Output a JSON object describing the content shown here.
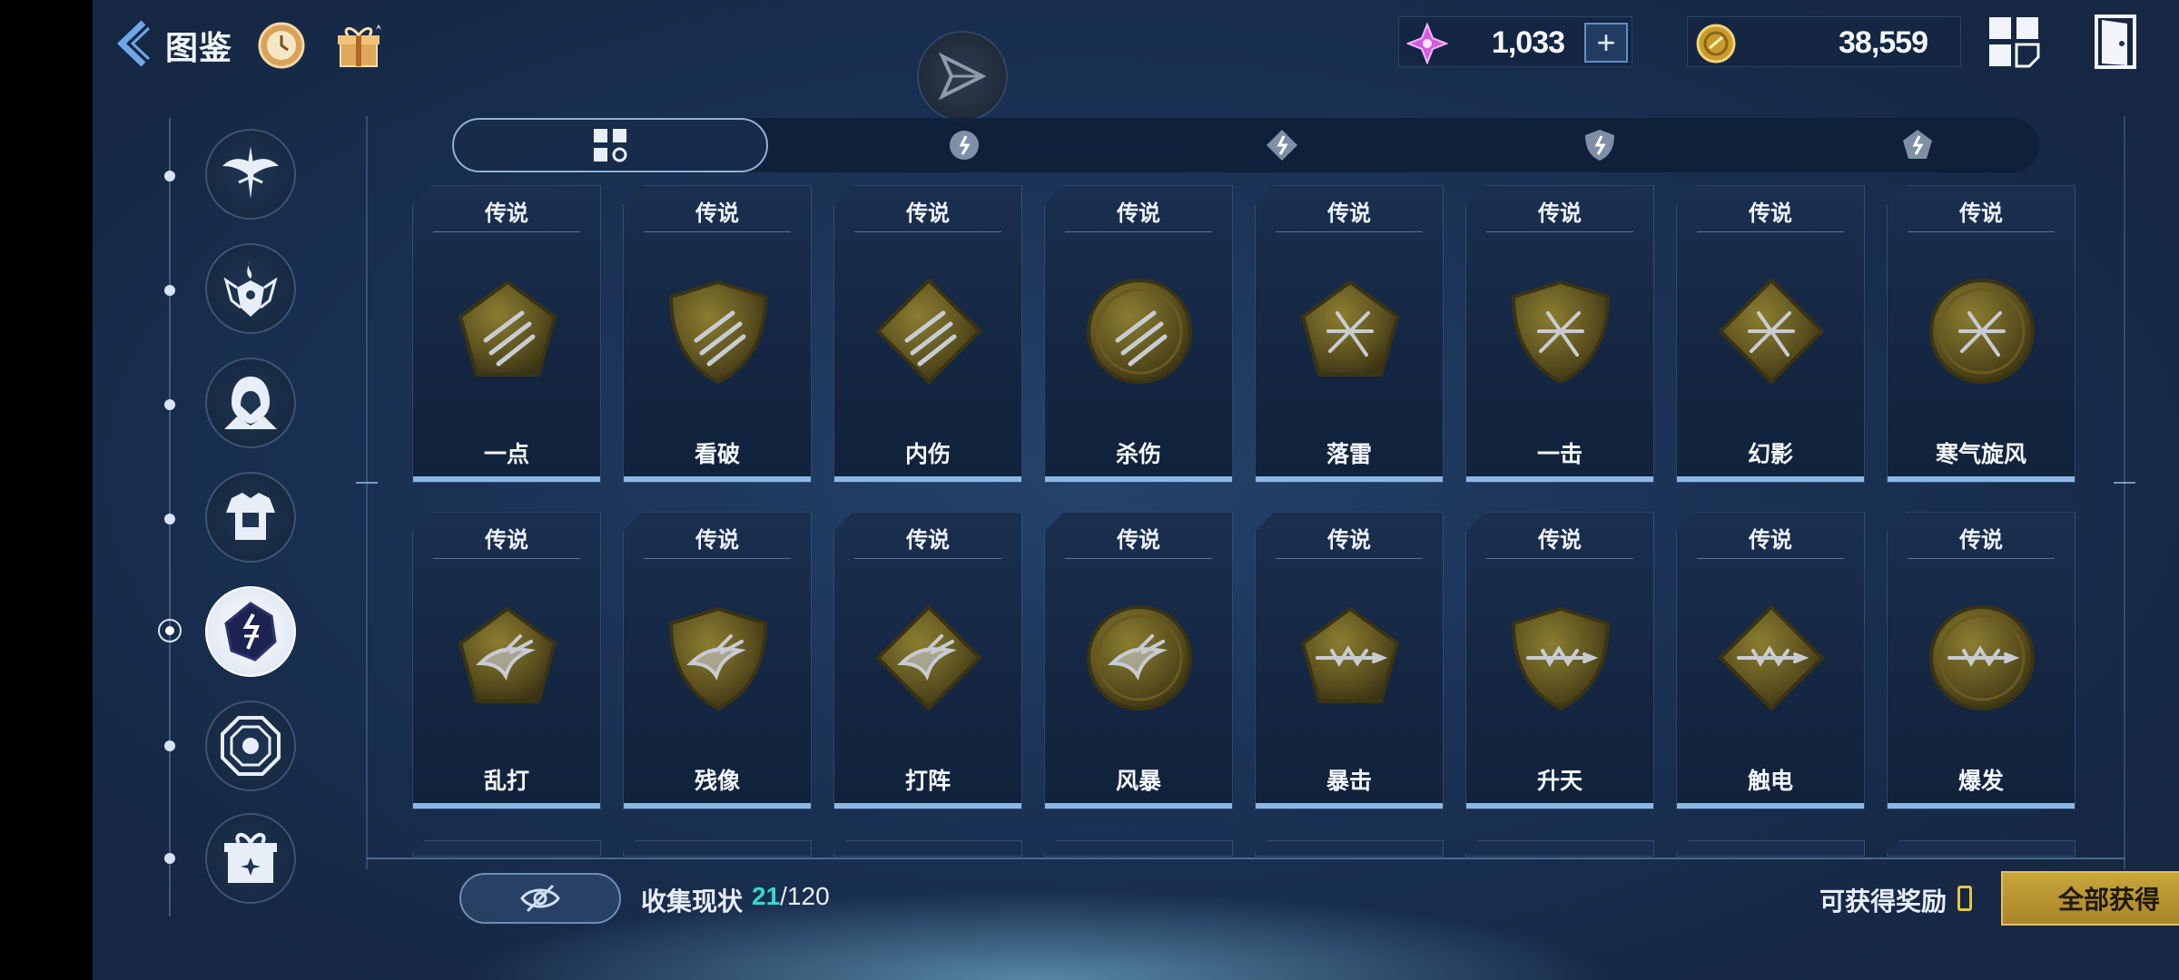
{
  "header": {
    "title": "图鉴",
    "currency_gem": {
      "value": "1,033",
      "plus": "+"
    },
    "currency_gold": {
      "value": "38,559"
    }
  },
  "sidebar": {
    "items": [
      {
        "icon": "winged-sword-icon",
        "active": false
      },
      {
        "icon": "flame-crest-icon",
        "active": false
      },
      {
        "icon": "hooded-figure-icon",
        "active": false
      },
      {
        "icon": "armor-icon",
        "active": false
      },
      {
        "icon": "rune-stone-icon",
        "active": true
      },
      {
        "icon": "octagon-gem-icon",
        "active": false
      },
      {
        "icon": "gift-box-icon",
        "active": false
      }
    ]
  },
  "tabs": [
    {
      "icon": "grid-icon",
      "active": true
    },
    {
      "icon": "rune-diamond-icon",
      "active": false
    },
    {
      "icon": "rune-pentagon-icon",
      "active": false
    },
    {
      "icon": "rune-shield-icon",
      "active": false
    },
    {
      "icon": "rune-round-icon",
      "active": false
    }
  ],
  "cards": [
    {
      "rarity": "传说",
      "name": "一点",
      "shape": "pentagon",
      "mark": "claw"
    },
    {
      "rarity": "传说",
      "name": "看破",
      "shape": "shield",
      "mark": "claw"
    },
    {
      "rarity": "传说",
      "name": "内伤",
      "shape": "diamond",
      "mark": "claw"
    },
    {
      "rarity": "传说",
      "name": "杀伤",
      "shape": "round",
      "mark": "claw"
    },
    {
      "rarity": "传说",
      "name": "落雷",
      "shape": "pentagon",
      "mark": "cross"
    },
    {
      "rarity": "传说",
      "name": "一击",
      "shape": "shield",
      "mark": "cross"
    },
    {
      "rarity": "传说",
      "name": "幻影",
      "shape": "diamond",
      "mark": "cross"
    },
    {
      "rarity": "传说",
      "name": "寒气旋风",
      "shape": "round",
      "mark": "cross"
    },
    {
      "rarity": "传说",
      "name": "乱打",
      "shape": "pentagon",
      "mark": "bird"
    },
    {
      "rarity": "传说",
      "name": "残像",
      "shape": "shield",
      "mark": "bird"
    },
    {
      "rarity": "传说",
      "name": "打阵",
      "shape": "diamond",
      "mark": "bird"
    },
    {
      "rarity": "传说",
      "name": "风暴",
      "shape": "round",
      "mark": "bird"
    },
    {
      "rarity": "传说",
      "name": "暴击",
      "shape": "pentagon",
      "mark": "bolt"
    },
    {
      "rarity": "传说",
      "name": "升天",
      "shape": "shield",
      "mark": "bolt"
    },
    {
      "rarity": "传说",
      "name": "触电",
      "shape": "diamond",
      "mark": "bolt"
    },
    {
      "rarity": "传说",
      "name": "爆发",
      "shape": "round",
      "mark": "bolt"
    }
  ],
  "footer": {
    "collect_label": "收集现状",
    "collect_current": "21",
    "collect_total": "/120",
    "reward_label": "可获得奖励",
    "reward_count": "0",
    "claim_all": "全部获得"
  }
}
